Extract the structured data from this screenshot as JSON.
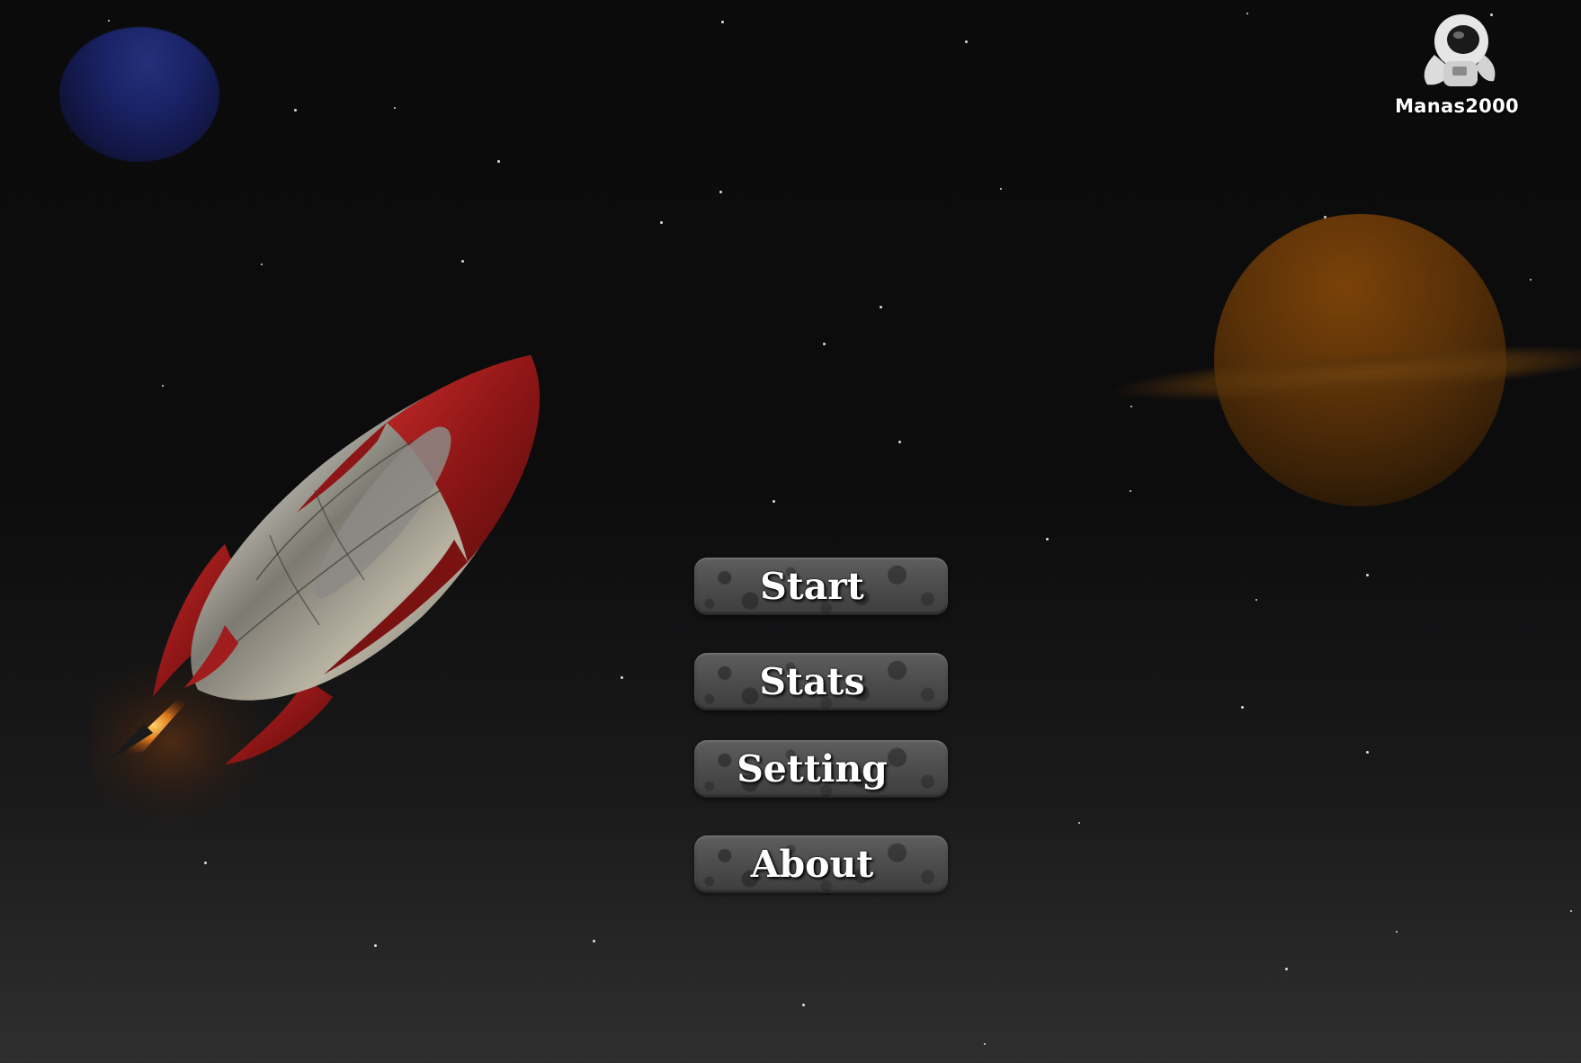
{
  "player": {
    "name": "Manas2000",
    "avatar_icon": "astronaut-icon"
  },
  "menu": {
    "items": [
      {
        "label": "Start"
      },
      {
        "label": "Stats"
      },
      {
        "label": "Setting"
      },
      {
        "label": "About"
      }
    ]
  },
  "scene": {
    "background": "starfield",
    "objects": [
      "blue-planet",
      "ringed-orange-planet",
      "red-retro-rocket"
    ],
    "colors": {
      "rocket_red": "#9e1e1e",
      "rocket_metal": "#8a8a86",
      "planet_blue": "#1f2a6e",
      "planet_orange": "#6b3a0a",
      "button_stone": "#505050"
    }
  }
}
